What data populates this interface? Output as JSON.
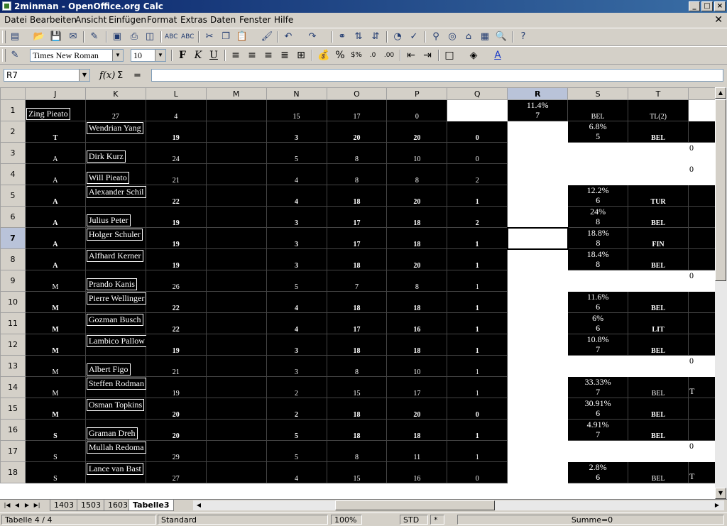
{
  "window": {
    "title": "2minman - OpenOffice.org Calc"
  },
  "menu": [
    "Datei",
    "Bearbeiten",
    "Ansicht",
    "Einfügen",
    "Format",
    "Extras",
    "Daten",
    "Fenster",
    "Hilfe"
  ],
  "format": {
    "font": "Times New Roman",
    "size": "10"
  },
  "formula_bar": {
    "cell_ref": "R7",
    "value": ""
  },
  "columns": [
    "J",
    "K",
    "L",
    "M",
    "N",
    "O",
    "P",
    "Q",
    "R",
    "S",
    "T"
  ],
  "rows": [
    {
      "n": "1",
      "J": "Zing Pieato",
      "K": "27",
      "L": "4",
      "N": "15",
      "O": "17",
      "P": "0",
      "R_pct": "11.4%",
      "R_n": "7",
      "S": "BEL",
      "T": "TL(2)"
    },
    {
      "n": "2",
      "J": "T",
      "K": "Wendrian Yang",
      "L": "19",
      "N": "3",
      "O": "20",
      "P": "20",
      "Q": "0",
      "S_pct": "6.8%",
      "S_n": "5",
      "T": "BEL"
    },
    {
      "n": "3",
      "J": "A",
      "K": "Dirk Kurz",
      "L": "24",
      "N": "5",
      "O": "8",
      "P": "10",
      "Q": "0",
      "edge": "0"
    },
    {
      "n": "4",
      "J": "A",
      "K": "Will Pieato",
      "L": "21",
      "N": "4",
      "O": "8",
      "P": "8",
      "Q": "2",
      "edge": "0"
    },
    {
      "n": "5",
      "J": "A",
      "K": "Alexander Schil",
      "L": "22",
      "N": "4",
      "O": "18",
      "P": "20",
      "Q": "1",
      "S_pct": "12.2%",
      "S_n": "6",
      "T": "TUR"
    },
    {
      "n": "6",
      "J": "A",
      "K": "Julius Peter",
      "L": "19",
      "N": "3",
      "O": "17",
      "P": "18",
      "Q": "2",
      "S_pct": "24%",
      "S_n": "8",
      "T": "BEL"
    },
    {
      "n": "7",
      "J": "A",
      "K": "Holger Schuler",
      "L": "19",
      "N": "3",
      "O": "17",
      "P": "18",
      "Q": "1",
      "S_pct": "18.8%",
      "S_n": "8",
      "T": "FIN"
    },
    {
      "n": "8",
      "J": "A",
      "K": "Alfhard Kerner",
      "L": "19",
      "N": "3",
      "O": "18",
      "P": "20",
      "Q": "1",
      "S_pct": "18.4%",
      "S_n": "8",
      "T": "BEL"
    },
    {
      "n": "9",
      "J": "M",
      "K": "Prando Kanis",
      "L": "26",
      "N": "5",
      "O": "7",
      "P": "8",
      "Q": "1",
      "edge": "0"
    },
    {
      "n": "10",
      "J": "M",
      "K": "Pierre Wellinger",
      "L": "22",
      "N": "4",
      "O": "18",
      "P": "18",
      "Q": "1",
      "S_pct": "11.6%",
      "S_n": "6",
      "T": "BEL"
    },
    {
      "n": "11",
      "J": "M",
      "K": "Gozman Busch",
      "L": "22",
      "N": "4",
      "O": "17",
      "P": "16",
      "Q": "1",
      "S_pct": "6%",
      "S_n": "6",
      "T": "LIT"
    },
    {
      "n": "12",
      "J": "M",
      "K": "Lambico Pallow",
      "L": "19",
      "N": "3",
      "O": "18",
      "P": "18",
      "Q": "1",
      "S_pct": "10.8%",
      "S_n": "7",
      "T": "BEL"
    },
    {
      "n": "13",
      "J": "M",
      "K": "Albert Figo",
      "L": "21",
      "N": "3",
      "O": "8",
      "P": "10",
      "Q": "1",
      "edge": "0"
    },
    {
      "n": "14",
      "J": "M",
      "K": "Steffen Rodman",
      "L": "19",
      "N": "2",
      "O": "15",
      "P": "17",
      "Q": "1",
      "S_pct": "33.33%",
      "S_n": "7",
      "T": "BEL",
      "edge": "T"
    },
    {
      "n": "15",
      "J": "M",
      "K": "Osman Topkins",
      "L": "20",
      "N": "2",
      "O": "18",
      "P": "20",
      "Q": "0",
      "S_pct": "30.91%",
      "S_n": "6",
      "T": "BEL"
    },
    {
      "n": "16",
      "J": "S",
      "K": "Graman Dreh",
      "L": "20",
      "N": "5",
      "O": "18",
      "P": "18",
      "Q": "1",
      "S_pct": "4.91%",
      "S_n": "7",
      "T": "BEL"
    },
    {
      "n": "17",
      "J": "S",
      "K": "Mullah Redoma",
      "L": "29",
      "N": "5",
      "O": "8",
      "P": "11",
      "Q": "1",
      "edge": "0"
    },
    {
      "n": "18",
      "J": "S",
      "K": "Lance van Bast",
      "L": "27",
      "N": "4",
      "O": "15",
      "P": "16",
      "Q": "0",
      "S_pct": "2.8%",
      "S_n": "6",
      "T": "BEL",
      "edge": "T"
    }
  ],
  "sheet_tabs": [
    "1403",
    "1503",
    "1603",
    "Tabelle3"
  ],
  "status": {
    "sheet": "Tabelle 4 / 4",
    "style": "Standard",
    "zoom": "100%",
    "mode": "STD",
    "modified": "*",
    "sum": "Summe=0"
  }
}
